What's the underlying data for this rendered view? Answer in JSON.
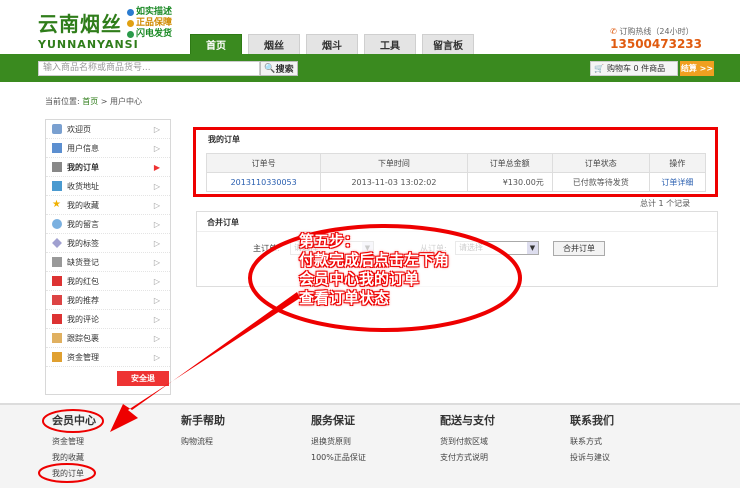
{
  "brand": {
    "name_cn": "云南烟丝",
    "name_en": "YUNNANYANSI",
    "slogans": [
      "如实描述",
      "正品保障",
      "闪电发货"
    ],
    "slogan_colors": [
      "#2a7bd0",
      "#e0a010",
      "#2a9a4a"
    ]
  },
  "nav": {
    "tabs": [
      "首页",
      "烟丝",
      "烟斗",
      "工具",
      "留言板"
    ],
    "active_index": 0
  },
  "hotline": {
    "label": "订购热线（24小时）",
    "number": "13500473233"
  },
  "search": {
    "placeholder": "输入商品名称或商品货号...",
    "button": "搜索"
  },
  "cart": {
    "label": "购物车 0 件商品",
    "checkout": "结算 >>"
  },
  "breadcrumb": {
    "prefix": "当前位置:",
    "home": "首页",
    "separator": ">",
    "current": "用户中心"
  },
  "sidebar": {
    "items": [
      {
        "label": "欢迎页",
        "icon": "home-icon"
      },
      {
        "label": "用户信息",
        "icon": "user-card-icon"
      },
      {
        "label": "我的订单",
        "icon": "order-icon"
      },
      {
        "label": "收货地址",
        "icon": "address-icon"
      },
      {
        "label": "我的收藏",
        "icon": "star-icon"
      },
      {
        "label": "我的留言",
        "icon": "message-icon"
      },
      {
        "label": "我的标签",
        "icon": "tag-icon"
      },
      {
        "label": "缺货登记",
        "icon": "register-icon"
      },
      {
        "label": "我的红包",
        "icon": "red-packet-icon"
      },
      {
        "label": "我的推荐",
        "icon": "recommend-icon"
      },
      {
        "label": "我的评论",
        "icon": "comment-icon"
      },
      {
        "label": "跟踪包裹",
        "icon": "package-icon"
      },
      {
        "label": "资金管理",
        "icon": "money-icon"
      }
    ],
    "active_index": 2,
    "safe_button": "安全退"
  },
  "orders": {
    "title": "我的订单",
    "columns": [
      "订单号",
      "下单时间",
      "订单总金额",
      "订单状态",
      "操作"
    ],
    "rows": [
      {
        "order_no": "2013110330053",
        "time": "2013-11-03 13:02:02",
        "amount": "¥130.00元",
        "status": "已付款等待发货",
        "action": "订单详细"
      }
    ],
    "total": "总计 1 个记录"
  },
  "merge": {
    "title": "合并订单",
    "main_label": "主订单:",
    "main_placeholder": "请选择",
    "from_label": "从订单:",
    "from_placeholder": "请选择",
    "button": "合并订单"
  },
  "annotation": {
    "lines": [
      "第五步：",
      "付款完成后点击左下角",
      "会员中心我的订单",
      "查看订单状态"
    ],
    "color": "#e00000"
  },
  "footer": {
    "columns": [
      {
        "title": "会员中心",
        "links": [
          "资金管理",
          "我的收藏",
          "我的订单"
        ]
      },
      {
        "title": "新手帮助",
        "links": [
          "购物流程"
        ]
      },
      {
        "title": "服务保证",
        "links": [
          "退换货原则",
          "100%正品保证"
        ]
      },
      {
        "title": "配送与支付",
        "links": [
          "货到付款区域",
          "支付方式说明"
        ]
      },
      {
        "title": "联系我们",
        "links": [
          "联系方式",
          "投诉与建议"
        ]
      }
    ]
  }
}
